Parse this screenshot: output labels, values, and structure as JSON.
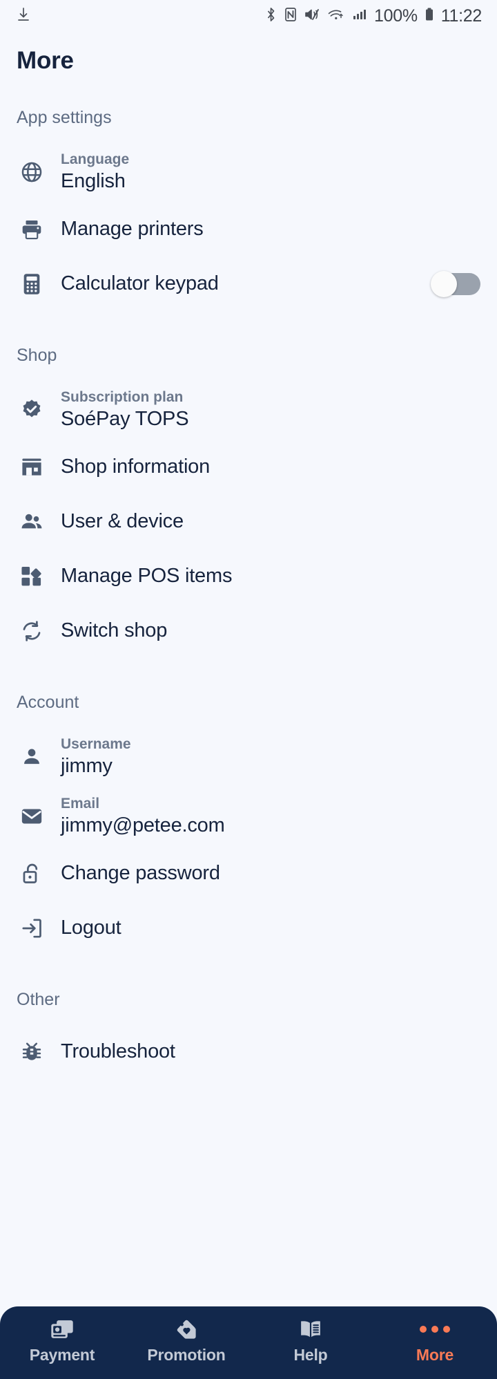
{
  "status_bar": {
    "download_icon": "download-icon",
    "bluetooth_icon": "bluetooth-icon",
    "nfc_icon": "nfc-icon",
    "mute_icon": "volume-mute-icon",
    "wifi_icon": "wifi-icon",
    "signal_icon": "cellular-signal-icon",
    "battery_percent": "100%",
    "battery_icon": "battery-full-icon",
    "clock": "11:22"
  },
  "header": {
    "title": "More"
  },
  "sections": [
    {
      "title": "App settings",
      "rows": [
        {
          "icon": "globe-icon",
          "sublabel": "Language",
          "value": "English"
        },
        {
          "icon": "printer-icon",
          "label": "Manage printers"
        },
        {
          "icon": "calculator-icon",
          "label": "Calculator keypad",
          "toggle": "off"
        }
      ]
    },
    {
      "title": "Shop",
      "rows": [
        {
          "icon": "verified-badge-icon",
          "sublabel": "Subscription plan",
          "value": "SoéPay TOPS"
        },
        {
          "icon": "storefront-icon",
          "label": "Shop information"
        },
        {
          "icon": "people-icon",
          "label": "User & device"
        },
        {
          "icon": "grid-items-icon",
          "label": "Manage POS items"
        },
        {
          "icon": "switch-shop-icon",
          "label": "Switch shop"
        }
      ]
    },
    {
      "title": "Account",
      "rows": [
        {
          "icon": "person-icon",
          "sublabel": "Username",
          "value": "jimmy"
        },
        {
          "icon": "envelope-icon",
          "sublabel": "Email",
          "value": "jimmy@petee.com"
        },
        {
          "icon": "unlock-icon",
          "label": "Change password"
        },
        {
          "icon": "logout-icon",
          "label": "Logout"
        }
      ]
    },
    {
      "title": "Other",
      "rows": [
        {
          "icon": "bug-icon",
          "label": "Troubleshoot"
        }
      ]
    }
  ],
  "bottom_nav": {
    "items": [
      {
        "icon": "payment-cards-icon",
        "label": "Payment",
        "active": false
      },
      {
        "icon": "promotion-tag-icon",
        "label": "Promotion",
        "active": false
      },
      {
        "icon": "help-book-icon",
        "label": "Help",
        "active": false
      },
      {
        "icon": "more-dots-icon",
        "label": "More",
        "active": true
      }
    ]
  },
  "colors": {
    "background": "#f6f8fd",
    "nav_background": "#12284c",
    "accent_active": "#f97a56",
    "nav_inactive": "#c3cad6",
    "text_primary": "#16233d",
    "text_secondary": "#6c788c",
    "icon": "#4d5c72",
    "toggle_track_off": "#9aa2ad"
  }
}
